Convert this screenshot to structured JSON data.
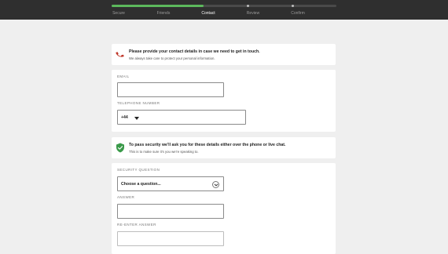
{
  "progress": {
    "steps": [
      "Secure",
      "Friends",
      "Contact",
      "Review",
      "Confirm"
    ],
    "active_step": "Contact",
    "fraction_complete": 0.41
  },
  "contact_notice": {
    "title": "Please provide your contact details in case we need to get in touch.",
    "subtitle": "We always take care to protect your personal information.",
    "icon": "phone-icon",
    "icon_color": "#c0392b"
  },
  "contact_form": {
    "email_label": "EMAIL",
    "email_value": "",
    "phone_label": "TELEPHONE NUMBER",
    "phone_code": "+44",
    "phone_value": ""
  },
  "security_notice": {
    "title": "To pass security we'll ask you for these details either over the phone or live chat.",
    "subtitle": "This is to make sure it's you we're speaking to.",
    "icon": "shield-check-icon",
    "icon_color": "#3a9a4a"
  },
  "security_form": {
    "question_label": "SECURITY QUESTION",
    "question_selected": "Choose a question...",
    "answer_label": "ANSWER",
    "answer_value": "",
    "reenter_label": "RE-ENTER ANSWER",
    "reenter_value": ""
  },
  "colors": {
    "accent_green": "#5cb85c",
    "topbar": "#2f2f2f",
    "background": "#efefef"
  }
}
